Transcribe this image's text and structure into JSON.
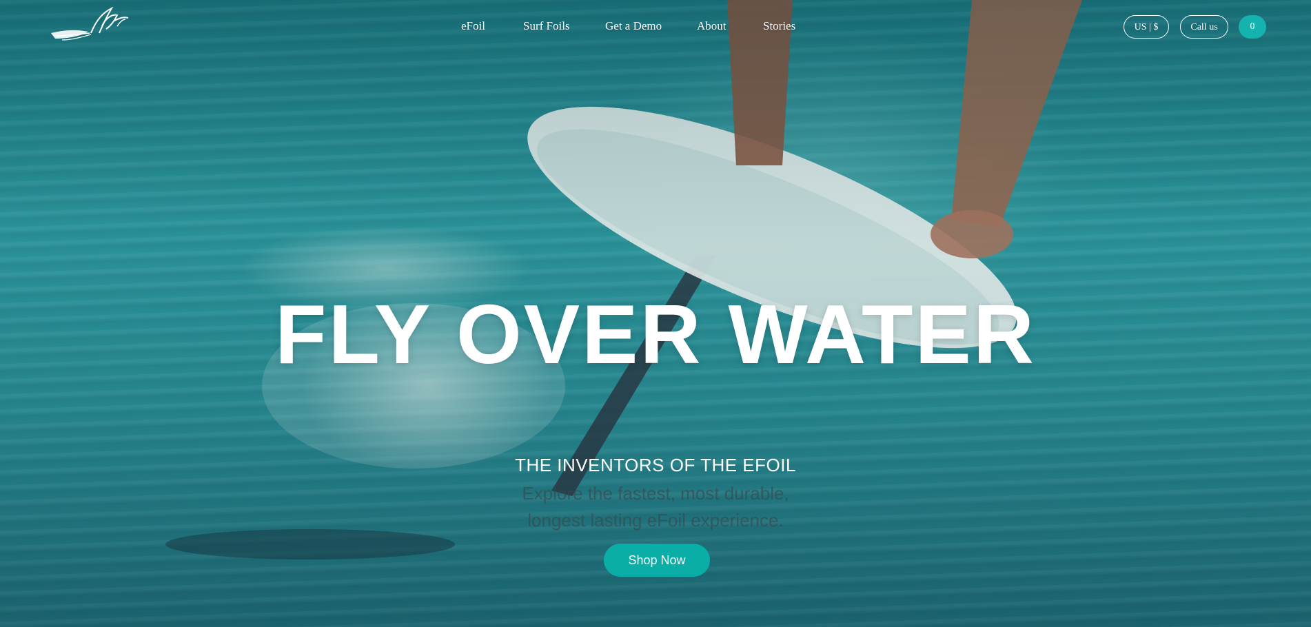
{
  "header": {
    "nav": [
      {
        "label": "eFoil"
      },
      {
        "label": "Surf Foils"
      },
      {
        "label": "Get a Demo"
      },
      {
        "label": "About"
      },
      {
        "label": "Stories"
      }
    ],
    "currency_label": "US | $",
    "call_label": "Call us",
    "cart_count": "0"
  },
  "hero": {
    "headline": "FLY OVER WATER",
    "subtitle": "THE INVENTORS OF THE EFOIL",
    "description_line1": "Explore the fastest, most durable,",
    "description_line2": "longest lasting eFoil experience.",
    "cta_label": "Shop Now"
  },
  "colors": {
    "accent": "#0aaea6",
    "text": "#ffffff"
  }
}
